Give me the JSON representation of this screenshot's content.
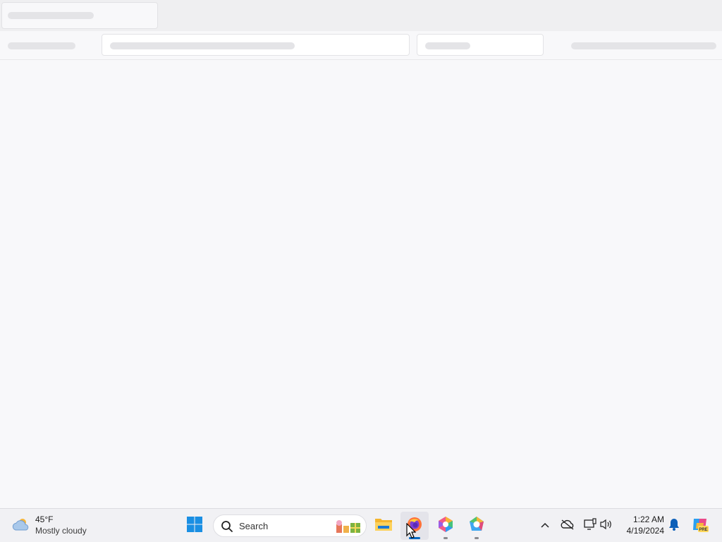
{
  "weather": {
    "temperature": "45°F",
    "condition": "Mostly cloudy",
    "icon": "cloud-icon"
  },
  "taskbar": {
    "search_label": "Search",
    "apps": [
      {
        "name": "start-button",
        "icon": "windows-logo-icon"
      },
      {
        "name": "file-explorer",
        "icon": "folder-icon"
      },
      {
        "name": "firefox",
        "icon": "firefox-icon",
        "active": true
      },
      {
        "name": "app-1",
        "icon": "colorful-app-icon"
      },
      {
        "name": "app-2",
        "icon": "copilot-style-icon"
      }
    ]
  },
  "tray": {
    "time": "1:22 AM",
    "date": "4/19/2024",
    "icons": [
      "chevron-up-icon",
      "onedrive-offline-icon",
      "network-icon",
      "volume-icon",
      "notification-bell-icon",
      "copilot-pre-icon"
    ]
  },
  "colors": {
    "accent": "#0067c0",
    "taskbar_bg": "#f1f1f4",
    "page_bg": "#f8f8fa"
  }
}
